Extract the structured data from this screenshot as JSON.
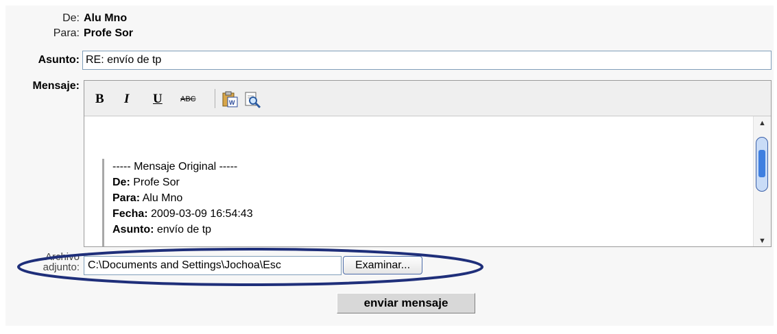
{
  "header": {
    "from_label": "De:",
    "from_value": "Alu Mno",
    "to_label": "Para:",
    "to_value": "Profe Sor",
    "subject_label": "Asunto:",
    "subject_value": "RE: envío de tp",
    "message_label": "Mensaje:"
  },
  "toolbar": {
    "bold": "B",
    "italic": "I",
    "underline": "U",
    "strike": "ABC"
  },
  "message": {
    "original_header": "----- Mensaje Original -----",
    "from_label": "De:",
    "from_value": " Profe Sor",
    "to_label": "Para:",
    "to_value": " Alu Mno",
    "date_label": "Fecha:",
    "date_value": " 2009-03-09 16:54:43",
    "subject_label": "Asunto:",
    "subject_value": " envío de tp"
  },
  "attachment": {
    "label_line1": "Archivo",
    "label_line2": "adjunto:",
    "path": "C:\\Documents and Settings\\Jochoa\\Esc",
    "browse_label": "Examinar..."
  },
  "actions": {
    "send_label": "enviar mensaje"
  },
  "colors": {
    "highlight_ellipse": "#1f2f7a",
    "input_border": "#7f9db9"
  }
}
